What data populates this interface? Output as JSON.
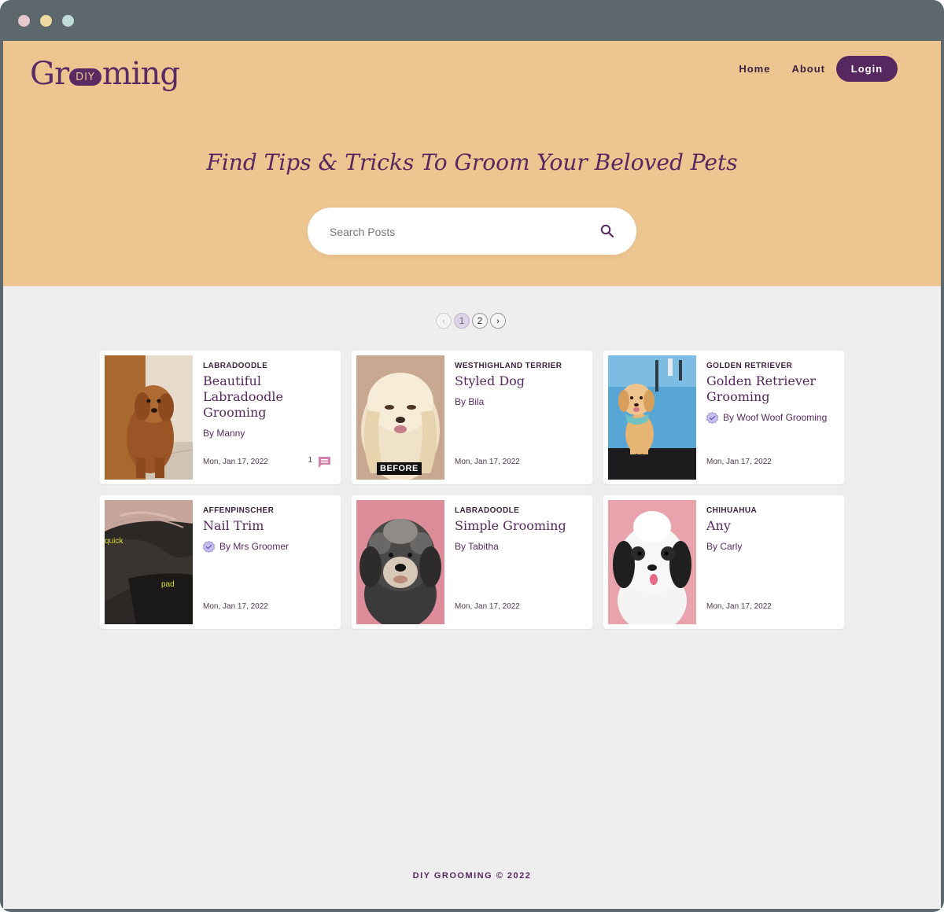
{
  "brand": {
    "logo_left": "Gr",
    "logo_pill": "DIY",
    "logo_right": "ming"
  },
  "nav": {
    "home": "Home",
    "about": "About",
    "login": "Login"
  },
  "hero": {
    "headline": "Find Tips & Tricks To Groom Your Beloved Pets",
    "search_placeholder": "Search Posts"
  },
  "pagination": {
    "prev": "‹",
    "pages": [
      "1",
      "2"
    ],
    "next": "›",
    "current": "1"
  },
  "posts": [
    {
      "category": "LABRADOODLE",
      "title": "Beautiful Labradoodle Grooming",
      "author": "By Manny",
      "verified": false,
      "date": "Mon, Jan 17, 2022",
      "comments": "1"
    },
    {
      "category": "WESTHIGHLAND TERRIER",
      "title": "Styled Dog",
      "author": "By Bila",
      "verified": false,
      "date": "Mon, Jan 17, 2022",
      "image_tag": "BEFORE"
    },
    {
      "category": "GOLDEN RETRIEVER",
      "title": "Golden Retriever Grooming",
      "author": "By Woof Woof Grooming",
      "verified": true,
      "date": "Mon, Jan 17, 2022"
    },
    {
      "category": "AFFENPINSCHER",
      "title": "Nail Trim",
      "author": "By Mrs Groomer",
      "verified": true,
      "date": "Mon, Jan 17, 2022",
      "image_labels": [
        "quick",
        "pad"
      ]
    },
    {
      "category": "LABRADOODLE",
      "title": "Simple Grooming",
      "author": "By Tabitha",
      "verified": false,
      "date": "Mon, Jan 17, 2022"
    },
    {
      "category": "CHIHUAHUA",
      "title": "Any",
      "author": "By Carly",
      "verified": false,
      "date": "Mon, Jan 17, 2022"
    }
  ],
  "footer": {
    "text": "DIY GROOMING © 2022"
  },
  "colors": {
    "hero_bg": "#ecc590",
    "brand_purple": "#57285f",
    "page_bg": "#eeeeee",
    "comment_icon": "#d180b0",
    "verified_icon": "#8b7dc9"
  },
  "icons": {
    "search": "search-icon",
    "comment": "comment-icon",
    "verified": "verified-badge-icon"
  }
}
